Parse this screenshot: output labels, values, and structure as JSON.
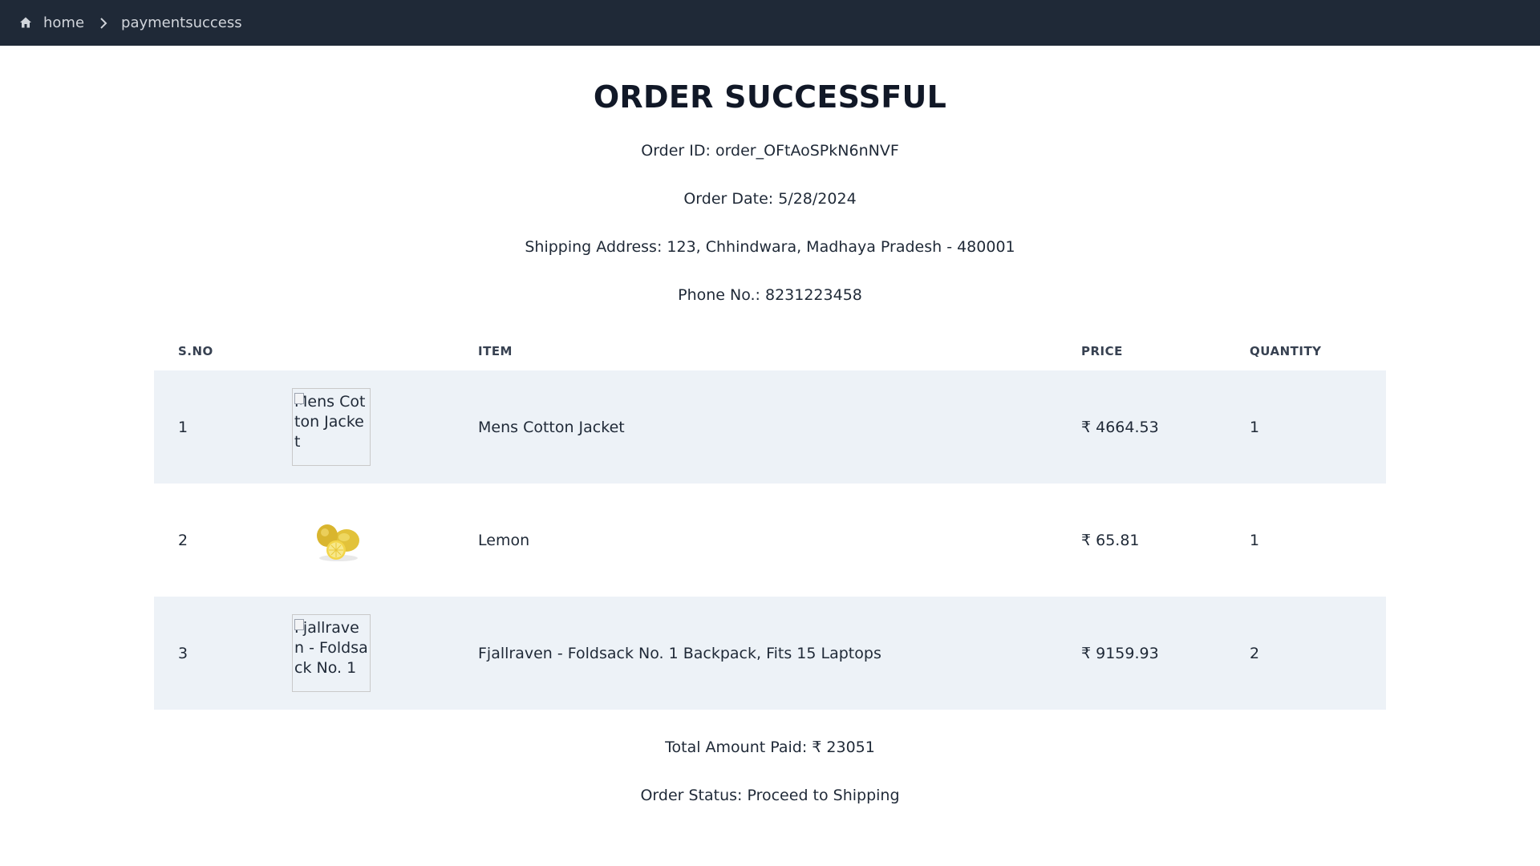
{
  "breadcrumb": {
    "home_label": "home",
    "current_label": "paymentsuccess"
  },
  "page": {
    "title": "ORDER SUCCESSFUL",
    "order_id": "Order ID: order_OFtAoSPkN6nNVF",
    "order_date": "Order Date: 5/28/2024",
    "shipping_address": "Shipping Address: 123, Chhindwara, Madhaya Pradesh - 480001",
    "phone": "Phone No.: 8231223458"
  },
  "table": {
    "headers": {
      "sno": "S.NO",
      "item": "ITEM",
      "price": "PRICE",
      "quantity": "QUANTITY"
    },
    "rows": [
      {
        "sno": "1",
        "image_alt": "Mens Cotton Jacket",
        "image_state": "broken",
        "item": "Mens Cotton Jacket",
        "price": "₹ 4664.53",
        "quantity": "1"
      },
      {
        "sno": "2",
        "image_alt": "Lemon",
        "image_state": "loaded",
        "item": "Lemon",
        "price": "₹ 65.81",
        "quantity": "1"
      },
      {
        "sno": "3",
        "image_alt": "Fjallraven - Foldsack No. 1",
        "image_state": "broken",
        "item": "Fjallraven - Foldsack No. 1 Backpack, Fits 15 Laptops",
        "price": "₹ 9159.93",
        "quantity": "2"
      }
    ]
  },
  "summary": {
    "total": "Total Amount Paid: ₹ 23051",
    "status": "Order Status: Proceed to Shipping"
  },
  "colors": {
    "topbar": "#1f2937",
    "row_shade": "#edf2f7",
    "text": "#1f2937"
  },
  "icons": {
    "home": "home-icon",
    "separator": "chevron-right-icon",
    "broken_image": "broken-image-icon"
  }
}
